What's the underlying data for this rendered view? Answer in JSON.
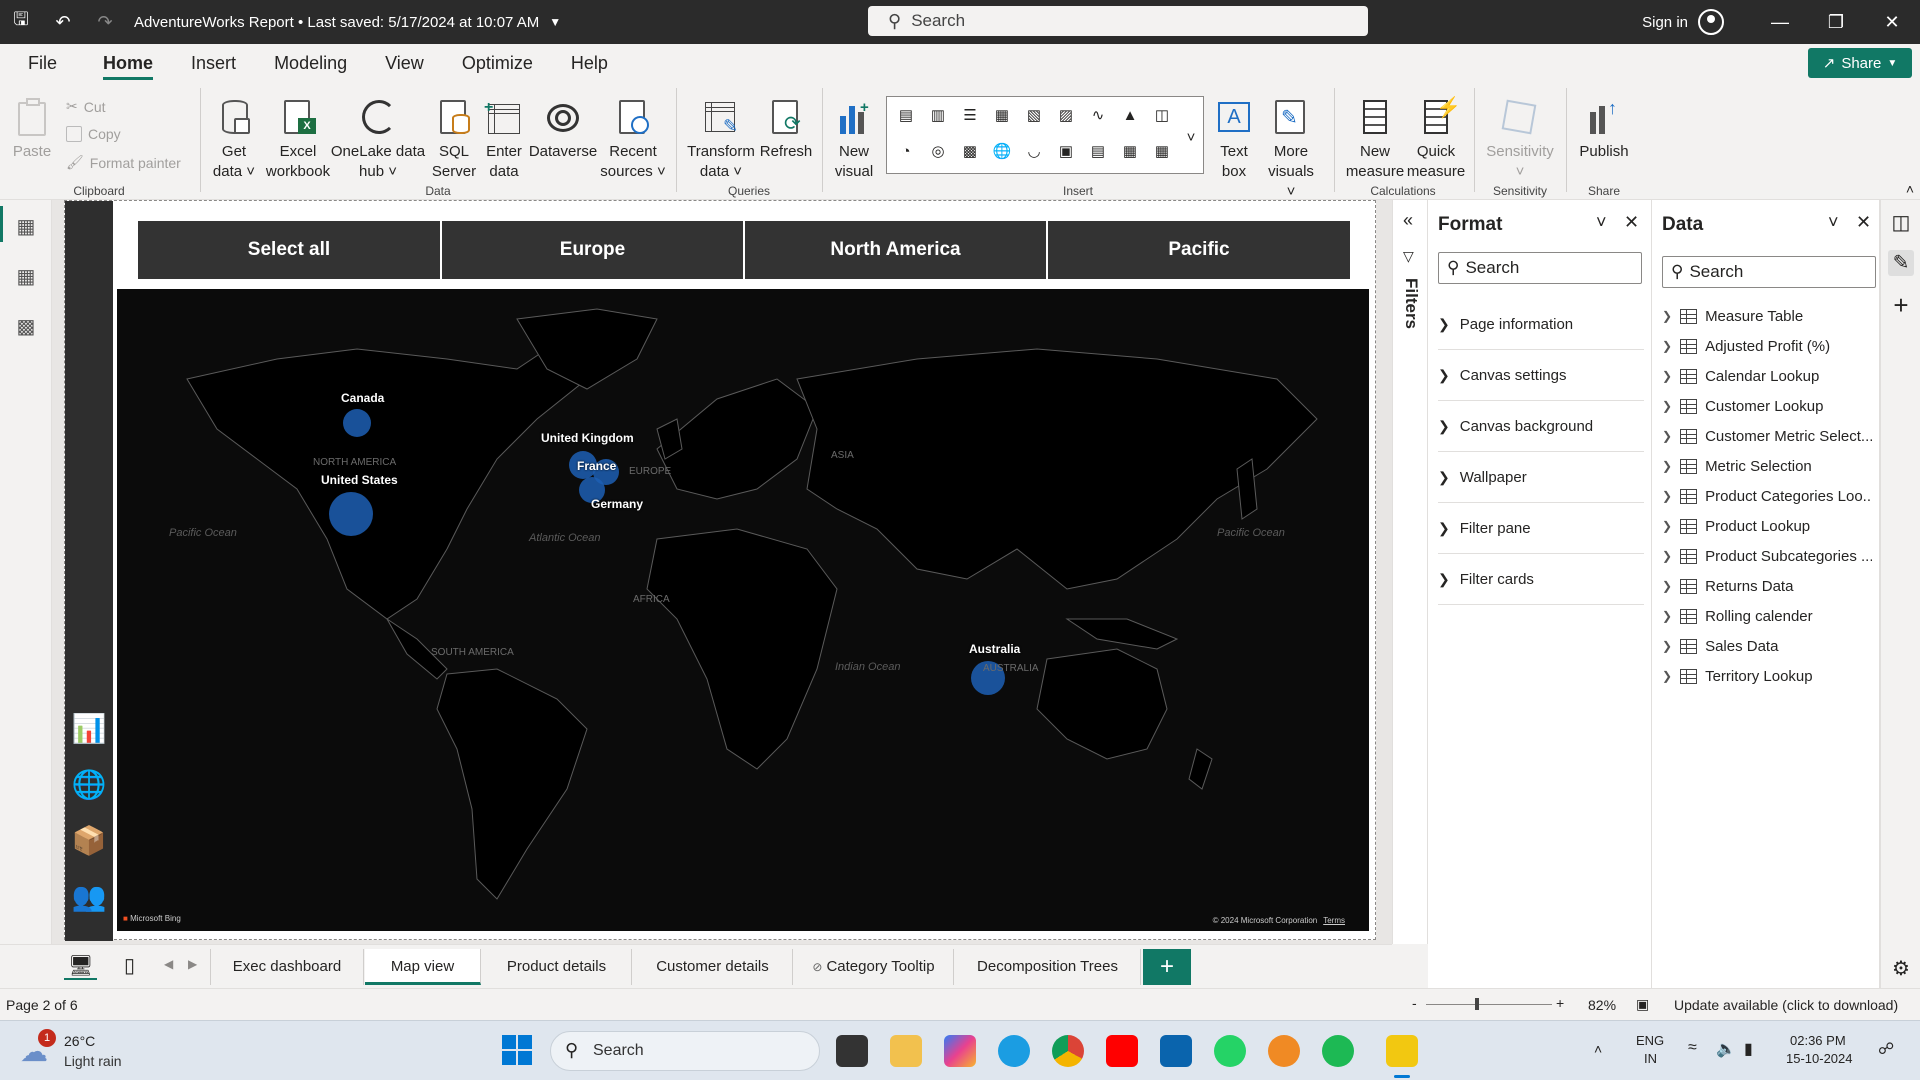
{
  "titlebar": {
    "title": "AdventureWorks Report • Last saved: 5/17/2024 at 10:07 AM",
    "search_placeholder": "Search",
    "signin": "Sign in"
  },
  "menu": {
    "items": [
      "File",
      "Home",
      "Insert",
      "Modeling",
      "View",
      "Optimize",
      "Help"
    ],
    "active": "Home",
    "share": "Share"
  },
  "ribbon": {
    "clipboard": {
      "paste": "Paste",
      "cut": "Cut",
      "copy": "Copy",
      "format_painter": "Format painter",
      "label": "Clipboard"
    },
    "data": {
      "get_data_1": "Get",
      "get_data_2": "data",
      "excel_1": "Excel",
      "excel_2": "workbook",
      "onelake_1": "OneLake data",
      "onelake_2": "hub",
      "sql_1": "SQL",
      "sql_2": "Server",
      "enter_1": "Enter",
      "enter_2": "data",
      "dataverse": "Dataverse",
      "recent_1": "Recent",
      "recent_2": "sources",
      "label": "Data"
    },
    "queries": {
      "transform_1": "Transform",
      "transform_2": "data",
      "refresh": "Refresh",
      "label": "Queries"
    },
    "insert": {
      "new_visual_1": "New",
      "new_visual_2": "visual",
      "text_box_1": "Text",
      "text_box_2": "box",
      "more_visuals_1": "More",
      "more_visuals_2": "visuals",
      "label": "Insert"
    },
    "calculations": {
      "new_measure_1": "New",
      "new_measure_2": "measure",
      "quick_measure_1": "Quick",
      "quick_measure_2": "measure",
      "label": "Calculations"
    },
    "sensitivity": {
      "sensitivity": "Sensitivity",
      "label": "Sensitivity"
    },
    "share": {
      "publish": "Publish",
      "label": "Share"
    }
  },
  "slicer": {
    "buttons": [
      "Select all",
      "Europe",
      "North America",
      "Pacific"
    ]
  },
  "map": {
    "labels": {
      "canada": "Canada",
      "united_states": "United States",
      "united_kingdom": "United Kingdom",
      "france": "France",
      "germany": "Germany",
      "australia": "Australia"
    },
    "regions": {
      "north_america": "NORTH AMERICA",
      "south_america": "SOUTH AMERICA",
      "europe": "EUROPE",
      "asia": "ASIA",
      "africa": "AFRICA",
      "australia": "AUSTRALIA"
    },
    "oceans": {
      "pacific_left": "Pacific Ocean",
      "atlantic": "Atlantic Ocean",
      "indian": "Indian Ocean",
      "pacific_right": "Pacific Ocean"
    },
    "logo": "Microsoft Bing",
    "copyright": "© 2024 Microsoft Corporation",
    "terms": "Terms",
    "bubble_color": "#1d5fb4"
  },
  "filters_label": "Filters",
  "format_pane": {
    "title": "Format",
    "search_placeholder": "Search",
    "items": [
      "Page information",
      "Canvas settings",
      "Canvas background",
      "Wallpaper",
      "Filter pane",
      "Filter cards"
    ]
  },
  "data_pane": {
    "title": "Data",
    "search_placeholder": "Search",
    "items": [
      "Measure Table",
      "Adjusted Profit (%)",
      "Calendar Lookup",
      "Customer Lookup",
      "Customer Metric Select...",
      "Metric Selection",
      "Product Categories Loo...",
      "Product Lookup",
      "Product Subcategories ...",
      "Returns Data",
      "Rolling calender",
      "Sales Data",
      "Territory Lookup"
    ]
  },
  "page_tabs": {
    "tabs": [
      "Exec dashboard",
      "Map view",
      "Product details",
      "Customer details",
      "Category Tooltip",
      "Decomposition Trees"
    ],
    "active": "Map view",
    "add": "+"
  },
  "status": {
    "page": "Page 2 of 6",
    "zoom": "82%",
    "update": "Update available (click to download)"
  },
  "taskbar": {
    "temp": "26°C",
    "weather": "Light rain",
    "badge": "1",
    "search": "Search",
    "lang1": "ENG",
    "lang2": "IN",
    "time": "02:36 PM",
    "date": "15-10-2024"
  },
  "colors": {
    "accent": "#117865",
    "titlebar": "#2b2b2b",
    "navbar": "#2e2e2e",
    "slicer": "#333333",
    "map_bg": "#0b0b0b"
  }
}
